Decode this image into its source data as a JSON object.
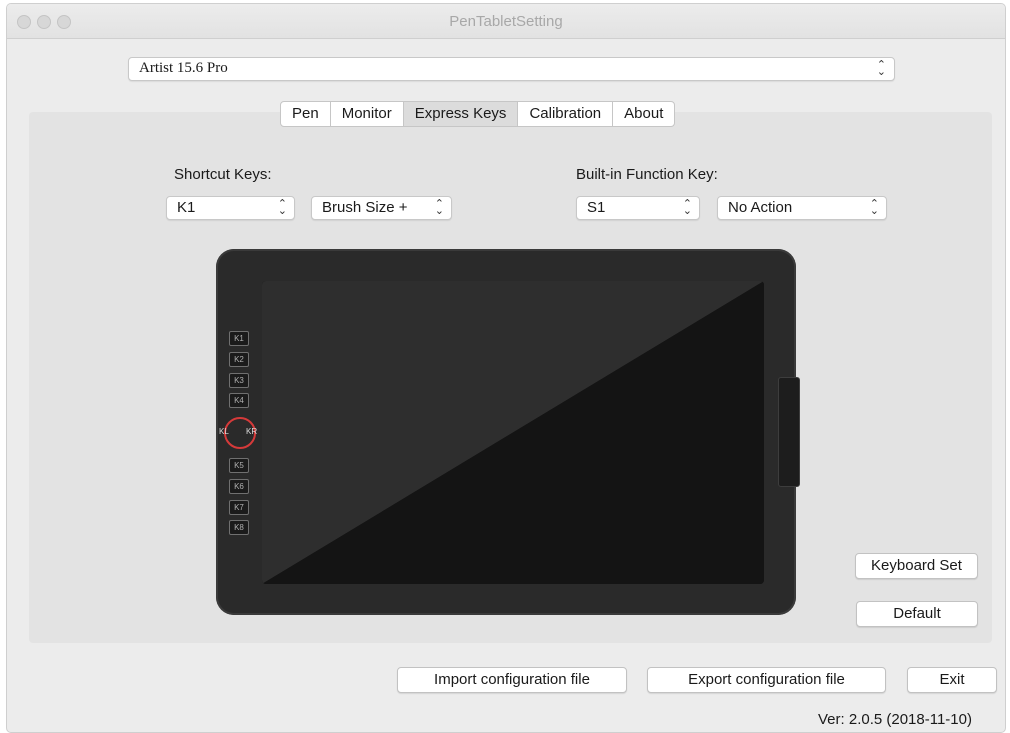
{
  "window": {
    "title": "PenTabletSetting"
  },
  "device": {
    "selected": "Artist 15.6 Pro"
  },
  "tabs": [
    {
      "label": "Pen"
    },
    {
      "label": "Monitor"
    },
    {
      "label": "Express Keys",
      "active": true
    },
    {
      "label": "Calibration"
    },
    {
      "label": "About"
    }
  ],
  "shortcut": {
    "label": "Shortcut Keys:",
    "key_value": "K1",
    "action_value": "Brush Size +"
  },
  "builtin": {
    "label": "Built-in Function Key:",
    "key_value": "S1",
    "action_value": "No Action"
  },
  "tablet": {
    "keys_top": [
      "K1",
      "K2",
      "K3",
      "K4"
    ],
    "dial_left": "KL",
    "dial_right": "KR",
    "keys_bottom": [
      "K5",
      "K6",
      "K7",
      "K8"
    ],
    "dial_highlight_color": "#d63a3a"
  },
  "buttons": {
    "keyboard_set": "Keyboard Set",
    "default": "Default",
    "import": "Import configuration file",
    "export": "Export configuration file",
    "exit": "Exit"
  },
  "version": "Ver: 2.0.5 (2018-11-10)",
  "icons": {
    "updown": "updown-chevron-icon",
    "traffic_lights": "window-control-icon"
  }
}
